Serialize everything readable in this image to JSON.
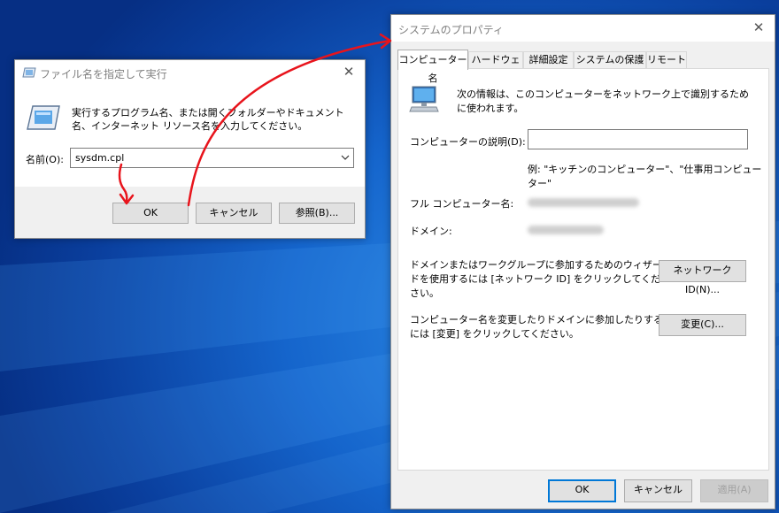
{
  "run_dialog": {
    "title": "ファイル名を指定して実行",
    "description": "実行するプログラム名、または開くフォルダーやドキュメント名、インターネット リソース名を入力してください。",
    "name_label": "名前(O):",
    "input_value": "sysdm.cpl",
    "ok_label": "OK",
    "cancel_label": "キャンセル",
    "browse_label": "参照(B)..."
  },
  "system_properties": {
    "title": "システムのプロパティ",
    "tabs": [
      "コンピューター名",
      "ハードウェア",
      "詳細設定",
      "システムの保護",
      "リモート"
    ],
    "active_tab": "コンピューター名",
    "info_text": "次の情報は、このコンピューターをネットワーク上で識別するために使われます。",
    "description_label": "コンピューターの説明(D):",
    "description_value": "",
    "example_text": "例: \"キッチンのコンピューター\"、\"仕事用コンピューター\"",
    "full_name_label": "フル コンピューター名:",
    "domain_label": "ドメイン:",
    "network_text": "ドメインまたはワークグループに参加するためのウィザードを使用するには [ネットワーク ID] をクリックしてください。",
    "network_button": "ネットワーク ID(N)...",
    "rename_text": "コンピューター名を変更したりドメインに参加したりするには [変更] をクリックしてください。",
    "change_button": "変更(C)...",
    "ok_label": "OK",
    "cancel_label": "キャンセル",
    "apply_label": "適用(A)"
  },
  "colors": {
    "annotation_arrow": "#e8141c",
    "focus_border": "#0078d7",
    "desktop_blue": "#1565cc"
  },
  "icons": {
    "run_title_icon": "run-icon",
    "run_large_icon": "run-icon",
    "system_icon": "computer-icon",
    "combo_arrow": "chevron-down-icon",
    "close": "close-icon"
  }
}
